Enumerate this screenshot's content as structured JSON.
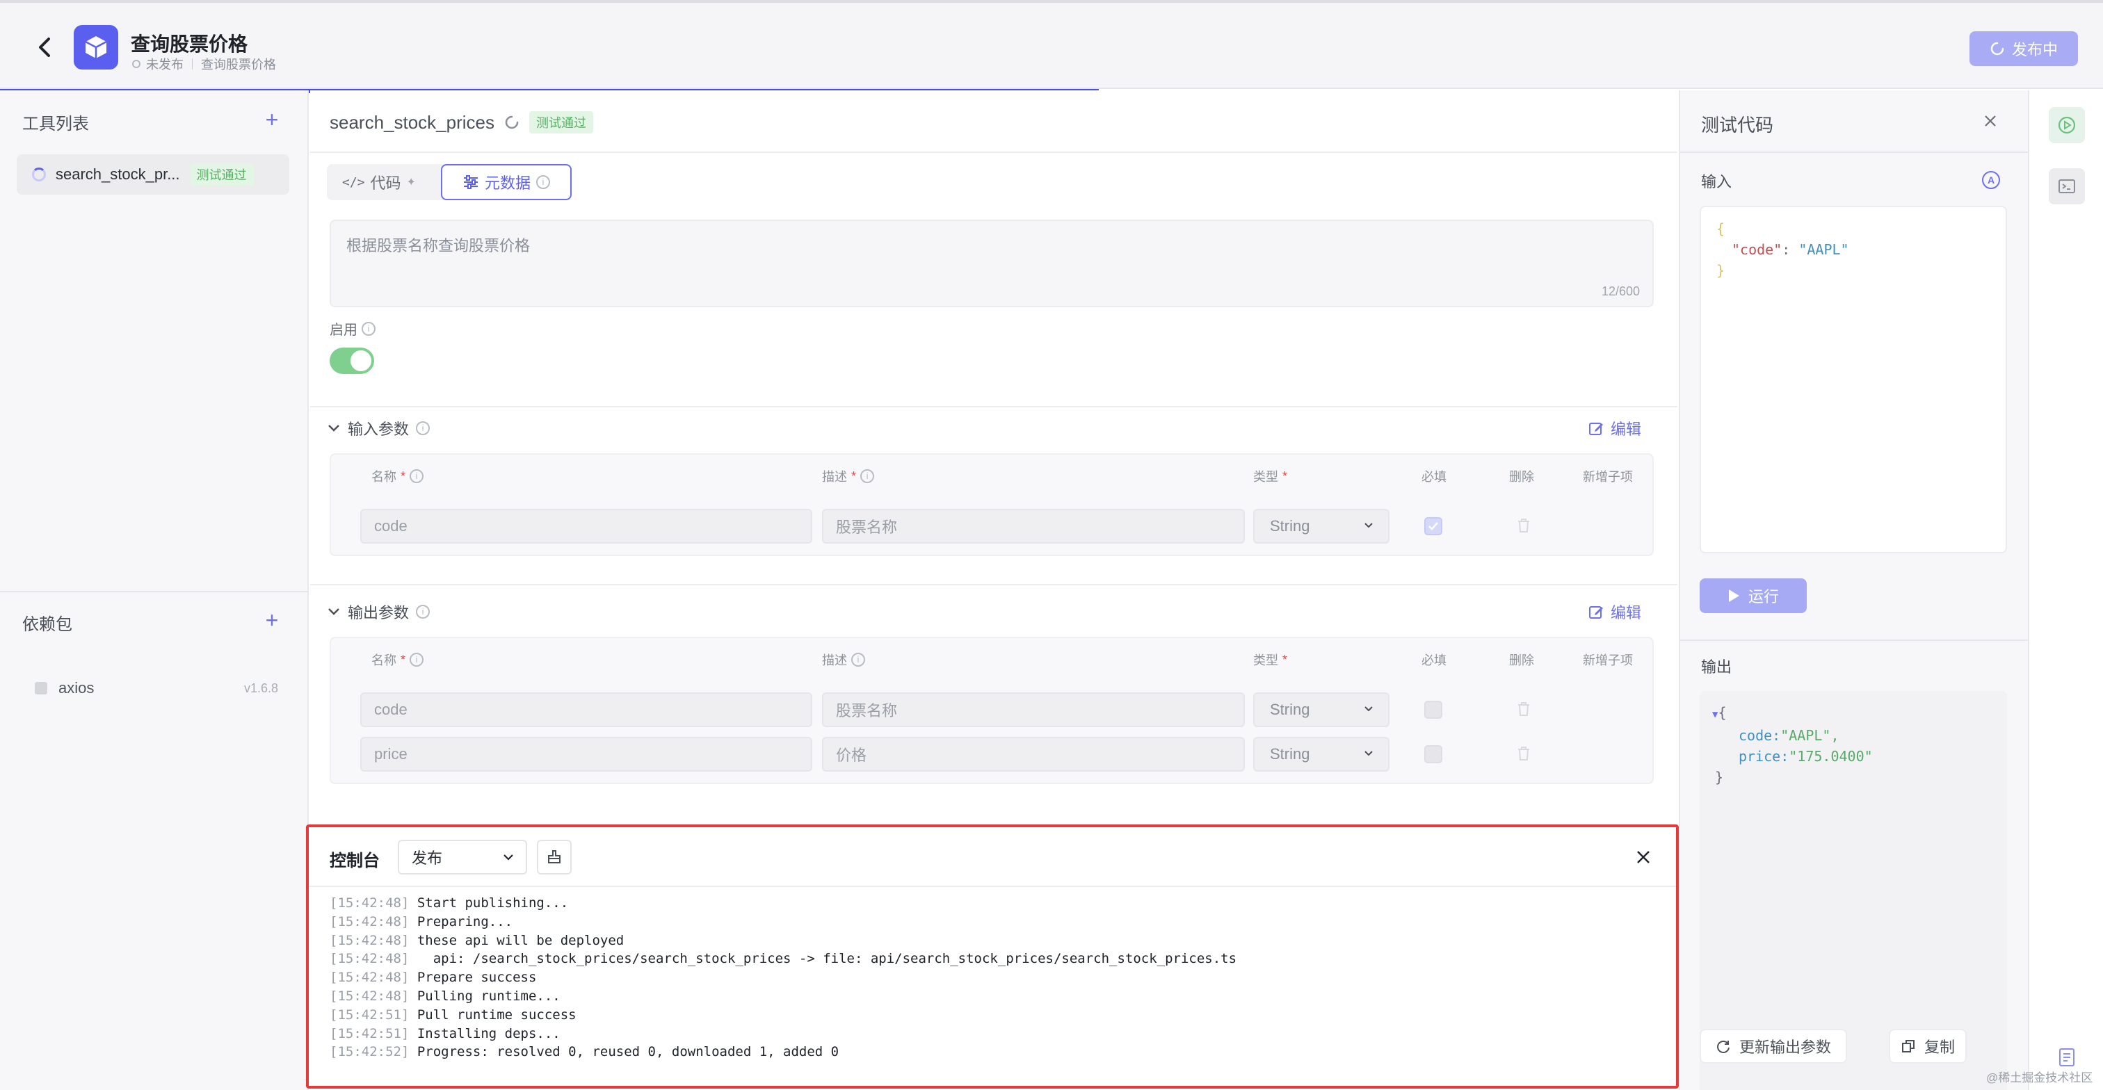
{
  "header": {
    "title": "查询股票价格",
    "status": "未发布",
    "breadcrumb": "查询股票价格",
    "publish_label": "发布中"
  },
  "left": {
    "tools_title": "工具列表",
    "tool_item": {
      "name": "search_stock_pr...",
      "badge": "测试通过"
    },
    "deps_title": "依赖包",
    "dep": {
      "name": "axios",
      "version": "v1.6.8"
    }
  },
  "editor": {
    "function_name": "search_stock_prices",
    "badge": "测试通过",
    "tabs": [
      {
        "label": "代码"
      },
      {
        "label": "元数据"
      }
    ],
    "description": "根据股票名称查询股票价格",
    "desc_count": "12/600",
    "enable_label": "启用",
    "enabled": true,
    "input_section": {
      "title": "输入参数",
      "edit_label": "编辑",
      "headers": {
        "name": "名称",
        "desc": "描述",
        "type": "类型",
        "required": "必填",
        "delete": "删除",
        "add_child": "新增子项"
      },
      "rows": [
        {
          "name": "code",
          "desc": "股票名称",
          "type": "String",
          "required": true
        }
      ]
    },
    "output_section": {
      "title": "输出参数",
      "edit_label": "编辑",
      "headers": {
        "name": "名称",
        "desc": "描述",
        "type": "类型",
        "required": "必填",
        "delete": "删除",
        "add_child": "新增子项"
      },
      "rows": [
        {
          "name": "code",
          "desc": "股票名称",
          "type": "String",
          "required": false
        },
        {
          "name": "price",
          "desc": "价格",
          "type": "String",
          "required": false
        }
      ]
    }
  },
  "console": {
    "title": "控制台",
    "select_value": "发布",
    "logs": [
      {
        "ts": "[15:42:48]",
        "msg": " Start publishing..."
      },
      {
        "ts": "[15:42:48]",
        "msg": " Preparing..."
      },
      {
        "ts": "[15:42:48]",
        "msg": " these api will be deployed"
      },
      {
        "ts": "[15:42:48]",
        "msg": "   api: /search_stock_prices/search_stock_prices -> file: api/search_stock_prices/search_stock_prices.ts"
      },
      {
        "ts": "[15:42:48]",
        "msg": " Prepare success"
      },
      {
        "ts": "[15:42:48]",
        "msg": " Pulling runtime..."
      },
      {
        "ts": "[15:42:51]",
        "msg": " Pull runtime success"
      },
      {
        "ts": "[15:42:51]",
        "msg": " Installing deps..."
      },
      {
        "ts": "[15:42:52]",
        "msg": " Progress: resolved 0, reused 0, downloaded 1, added 0"
      }
    ]
  },
  "test_panel": {
    "title": "测试代码",
    "input_label": "输入",
    "input_code": {
      "open": "{",
      "key": "\"code\"",
      "colon": ": ",
      "value": "\"AAPL\"",
      "close": "}"
    },
    "run_label": "运行",
    "output_label": "输出",
    "output_code": {
      "open": "{",
      "line1_key": "code:",
      "line1_val": "\"AAPL\",",
      "line2_key": "price:",
      "line2_val": "\"175.0400\"",
      "close": "}"
    },
    "update_label": "更新输出参数",
    "copy_label": "复制"
  },
  "watermark": "@稀土掘金技术社区",
  "colors": {
    "accent": "#5b5ff0",
    "success": "#58b064",
    "danger": "#e33b3b"
  }
}
